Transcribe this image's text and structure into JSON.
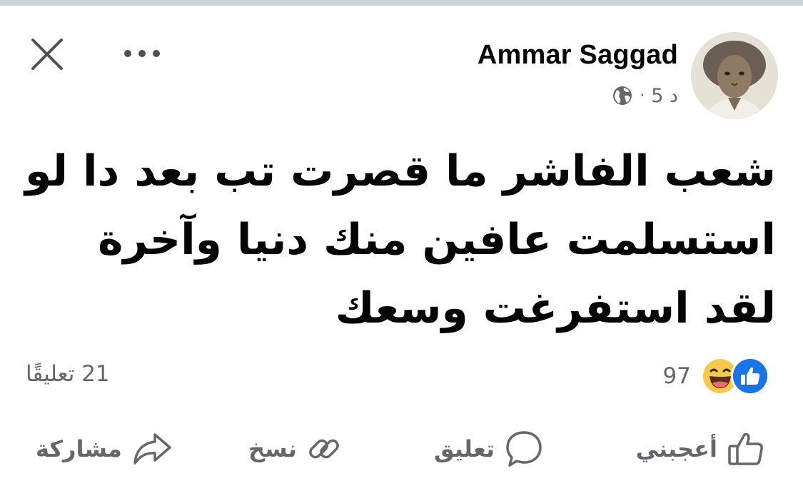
{
  "post": {
    "author": "Ammar Saggad",
    "time": "5 د",
    "separator": "·",
    "audience_icon": "globe-icon",
    "text": "شعب الفاشر ما قصرت تب بعد دا لو استسلمت عافين منك دنيا وآخرة لقد استفرغت وسعك"
  },
  "header": {
    "close_icon": "close-icon",
    "more_icon": "more-horizontal-icon"
  },
  "stats": {
    "reactions": [
      "like",
      "haha"
    ],
    "reaction_count": "97",
    "comments": "21 تعليقًا"
  },
  "actions": {
    "like": "أعجبني",
    "comment": "تعليق",
    "copy": "نسخ",
    "share": "مشاركة"
  },
  "colors": {
    "like_blue": "#1b74e4",
    "secondary_text": "#65676b",
    "primary_text": "#050505",
    "haha_yellow": "#f7c94b"
  }
}
